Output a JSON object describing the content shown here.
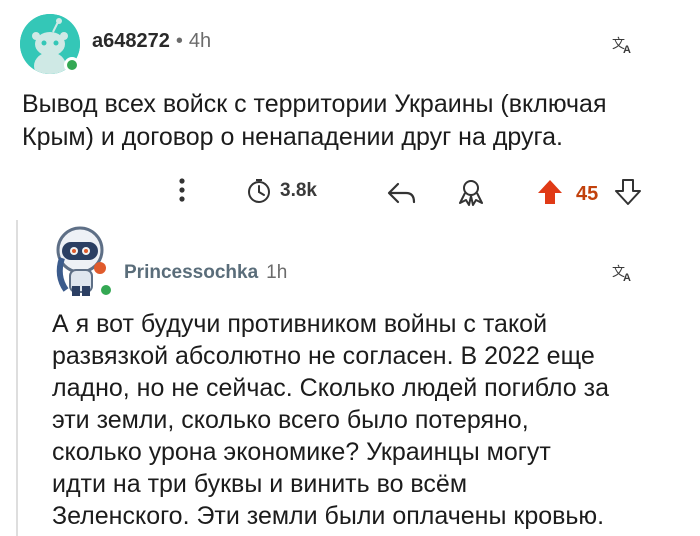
{
  "comment": {
    "username": "a648272",
    "separator": "•",
    "time": "4h",
    "text_line1": "Вывод всех войск с территории Украины (включая",
    "text_line2": "Крым) и договор о ненападении друг на друга.",
    "awards_count": "3.8k",
    "score": "45",
    "icons": [
      "more-vertical-icon",
      "award-icon",
      "reply-icon",
      "share-icon",
      "upvote-icon",
      "downvote-icon",
      "translate-icon"
    ],
    "colors": {
      "upvote": "#e03a16",
      "score": "#c2410c",
      "avatar_bg": "#34c7b7",
      "online": "#34a853"
    }
  },
  "reply": {
    "username": "Princessochka",
    "time": "1h",
    "text_lines": [
      "А я вот будучи противником войны с такой",
      "развязкой абсолютно не согласен. В 2022 еще",
      "ладно, но не сейчас. Сколько людей погибло за",
      "эти земли, сколько всего было потеряно,",
      "сколько урона экономике? Украинцы могут",
      "идти на три буквы и винить во всём",
      "Зеленского. Эти земли были оплачены кровью."
    ]
  }
}
